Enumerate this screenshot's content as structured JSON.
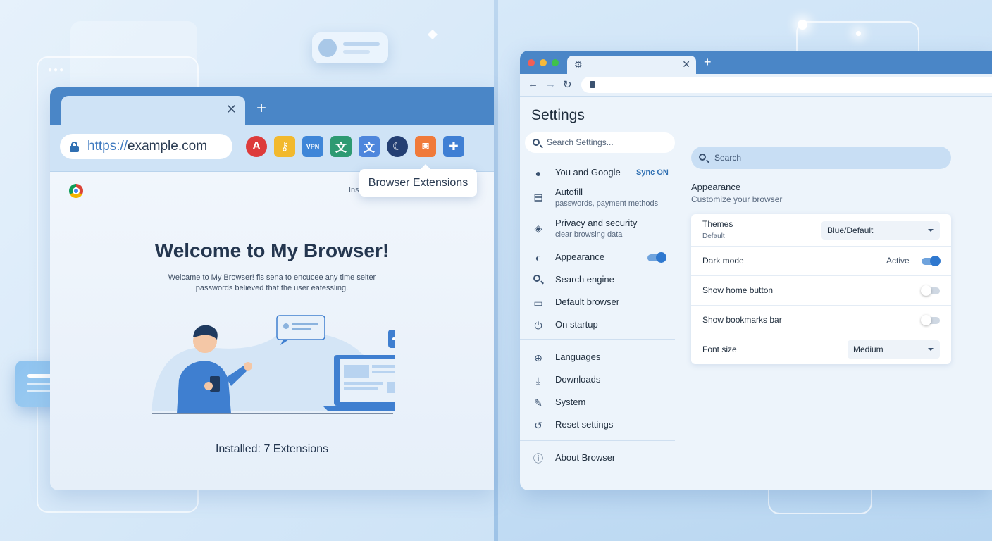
{
  "left_browser": {
    "url_protocol": "https://",
    "url_host": "example.com",
    "tooltip": "Browser Extensions",
    "ins_label": "Ins",
    "welcome_title": "Welcome to My Browser!",
    "welcome_subtitle_1": "Welcame to My Browser! fis sena to encucee any time selter",
    "welcome_subtitle_2": "passwords believed that the user eatessling.",
    "installed": "Installed: 7 Extensions",
    "extensions": [
      {
        "name": "angular-extension",
        "glyph": "A",
        "color": "#dd3b3b"
      },
      {
        "name": "password-key-extension",
        "glyph": "⚷",
        "color": "#f2b92e"
      },
      {
        "name": "vpn-extension",
        "glyph": "VPN",
        "color": "#3f86d8"
      },
      {
        "name": "translate-shield-extension",
        "glyph": "文",
        "color": "#2e9a72"
      },
      {
        "name": "google-translate-extension",
        "glyph": "文",
        "color": "#4e86dc"
      },
      {
        "name": "dark-mode-extension",
        "glyph": "☾",
        "color": "#243f73"
      },
      {
        "name": "screenshot-extension",
        "glyph": "◙",
        "color": "#f07a3a"
      },
      {
        "name": "extensions-puzzle",
        "glyph": "✚",
        "color": "#3f7fd4"
      }
    ]
  },
  "right_browser": {
    "settings_title": "Settings",
    "side_search_placeholder": "Search Settings...",
    "main_search_placeholder": "Search",
    "nav": [
      {
        "label": "You and Google",
        "badge": "Sync ON"
      },
      {
        "label": "Autofill",
        "sub": "passwords, payment methods"
      },
      {
        "label": "Privacy and security",
        "sub": "clear browsing data"
      },
      {
        "label": "Appearance",
        "toggle": true
      },
      {
        "label": "Search engine"
      },
      {
        "label": "Default browser"
      },
      {
        "label": "On startup"
      },
      {
        "label": "Languages"
      },
      {
        "label": "Downloads"
      },
      {
        "label": "System"
      },
      {
        "label": "Reset settings"
      },
      {
        "label": "About Browser"
      }
    ],
    "section_title": "Appearance",
    "section_subtitle": "Customize your browser",
    "rows": {
      "themes_label": "Themes",
      "themes_sub": "Default",
      "themes_value": "Blue/Default",
      "dark_mode_label": "Dark mode",
      "dark_mode_status": "Active",
      "home_button_label": "Show home button",
      "bookmarks_label": "Show bookmarks bar",
      "font_size_label": "Font size",
      "font_size_value": "Medium"
    }
  },
  "colors": {
    "accent": "#4a86c7",
    "toggle_on": "#2f78cf"
  }
}
